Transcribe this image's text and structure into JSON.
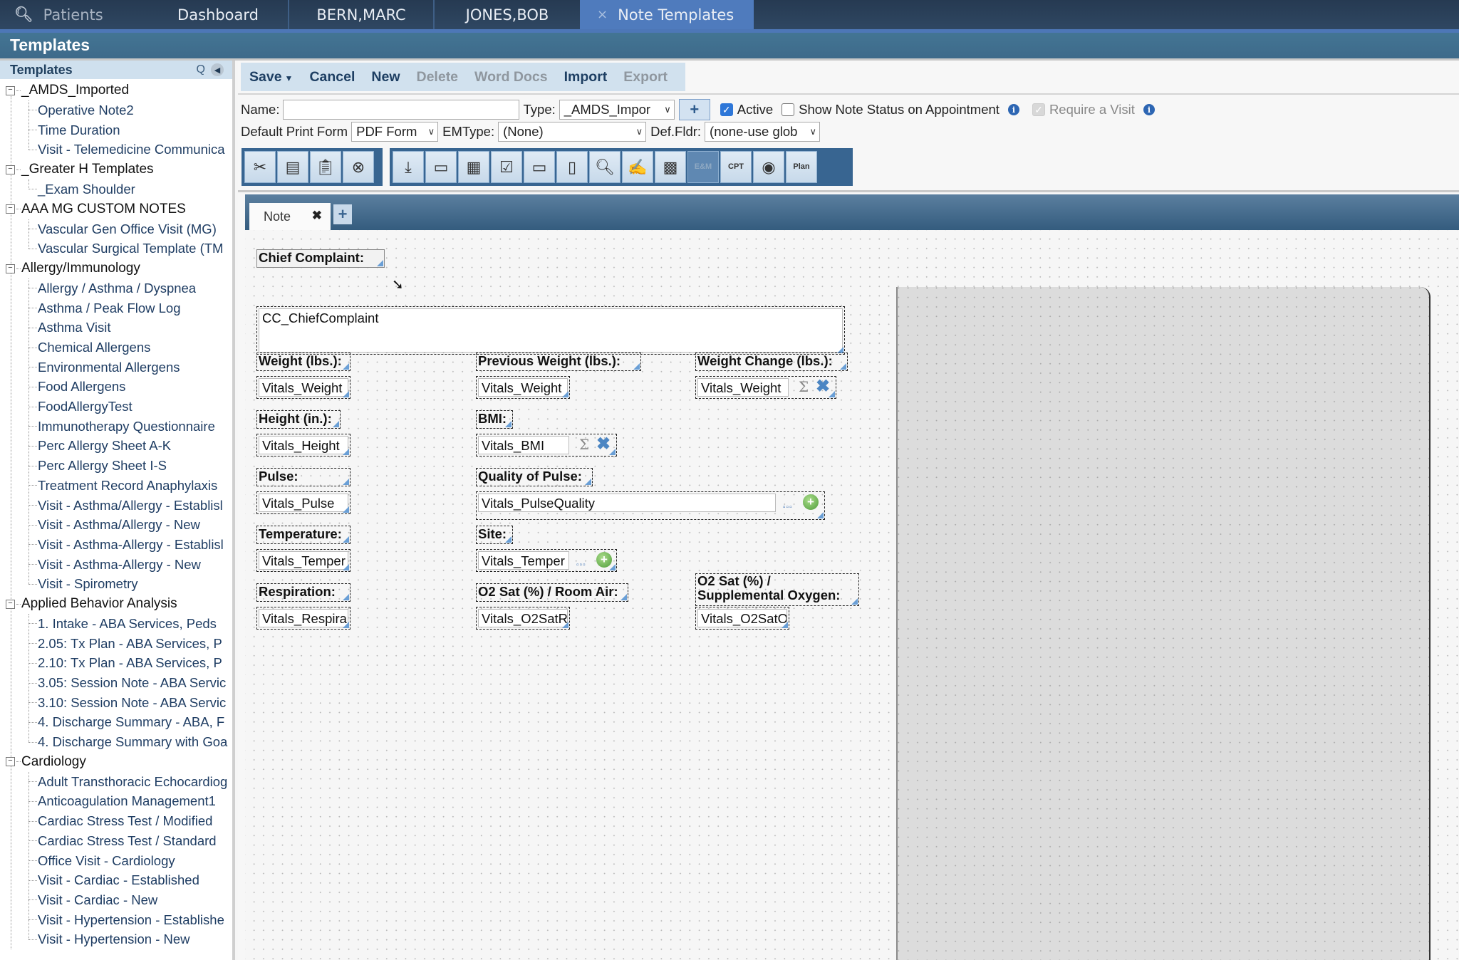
{
  "topnav": {
    "search_label": "Patients",
    "tabs": [
      {
        "label": "Dashboard"
      },
      {
        "label": "BERN,MARC"
      },
      {
        "label": "JONES,BOB"
      },
      {
        "label": "Note Templates",
        "active": true,
        "close": "×"
      }
    ]
  },
  "section_title": "Templates",
  "sidebar": {
    "title": "Templates",
    "search_icon": "Q",
    "collapse_icon": "◀",
    "groups": [
      {
        "label": "_AMDS_Imported",
        "items": [
          "Operative Note2",
          "Time Duration",
          "Visit - Telemedicine Communica"
        ]
      },
      {
        "label": "_Greater H Templates",
        "items": [
          "_Exam Shoulder"
        ]
      },
      {
        "label": "AAA MG CUSTOM NOTES",
        "items": [
          "Vascular Gen Office Visit (MG)",
          "Vascular Surgical Template (TM"
        ]
      },
      {
        "label": "Allergy/Immunology",
        "items": [
          "Allergy / Asthma / Dyspnea",
          "Asthma / Peak Flow Log",
          "Asthma Visit",
          "Chemical Allergens",
          "Environmental Allergens",
          "Food Allergens",
          "FoodAllergyTest",
          "Immunotherapy Questionnaire",
          "Perc Allergy Sheet A-K",
          "Perc Allergy Sheet I-S",
          "Treatment Record Anaphylaxis",
          "Visit - Asthma/Allergy - Establisl",
          "Visit - Asthma/Allergy - New",
          "Visit - Asthma-Allergy - Establisl",
          "Visit - Asthma-Allergy - New",
          "Visit - Spirometry"
        ]
      },
      {
        "label": "Applied Behavior Analysis",
        "items": [
          "1. Intake - ABA Services, Peds",
          "2.05: Tx Plan - ABA Services, P",
          "2.10: Tx Plan - ABA Services, P",
          "3.05: Session Note - ABA Servic",
          "3.10: Session Note - ABA Servic",
          "4. Discharge Summary - ABA, F",
          "4. Discharge Summary with Goa"
        ]
      },
      {
        "label": "Cardiology",
        "items": [
          "Adult Transthoracic Echocardiog",
          "Anticoagulation Management1",
          "Cardiac Stress Test / Modified",
          "Cardiac Stress Test / Standard",
          "Office Visit - Cardiology",
          "Visit - Cardiac - Established",
          "Visit - Cardiac - New",
          "Visit - Hypertension - Establishe",
          "Visit - Hypertension - New"
        ]
      }
    ]
  },
  "actions": {
    "save": "Save",
    "cancel": "Cancel",
    "new": "New",
    "delete": "Delete",
    "word_docs": "Word Docs",
    "import": "Import",
    "export": "Export"
  },
  "form": {
    "name_label": "Name:",
    "name_value": "",
    "type_label": "Type:",
    "type_value": "_AMDS_Impor",
    "add_type": "+",
    "active_label": "Active",
    "active_checked": true,
    "show_status_label": "Show Note Status on Appointment",
    "show_status_checked": false,
    "require_visit_label": "Require a Visit",
    "require_visit_checked": true,
    "print_form_label": "Default Print Form",
    "print_form_value": "PDF Form",
    "emtype_label": "EMType:",
    "emtype_value": "(None)",
    "deffldr_label": "Def.Fldr:",
    "deffldr_value": "(none-use glob"
  },
  "icon_toolbar": {
    "edit_group": [
      "cut-icon",
      "copy-icon",
      "paste-icon",
      "delete-icon"
    ],
    "insert_group": [
      "text-field-icon",
      "textbox-icon",
      "date-grid-icon",
      "checkbox-icon",
      "dropdown-icon",
      "list-icon",
      "lookup-icon",
      "signature-icon",
      "calculator-icon",
      "em-icon",
      "cpt-lookup-icon",
      "radio-icon",
      "plan-icon"
    ],
    "em_label": "E&M",
    "cpt_label": "CPT",
    "plan_label": "Plan"
  },
  "note_tabs": [
    {
      "label": "Note",
      "close": "✖"
    }
  ],
  "add_tab": "+",
  "canvas": {
    "fields": [
      {
        "id": "chief-complaint-label",
        "text": "Chief Complaint:"
      },
      {
        "id": "cc-field",
        "text": "CC_ChiefComplaint"
      },
      {
        "id": "weight-label",
        "text": "Weight (lbs.):"
      },
      {
        "id": "prev-weight-label",
        "text": "Previous Weight (lbs.):"
      },
      {
        "id": "weight-change-label",
        "text": "Weight Change (lbs.):"
      },
      {
        "id": "weight-field",
        "text": "Vitals_Weight"
      },
      {
        "id": "prev-weight-field",
        "text": "Vitals_Weight"
      },
      {
        "id": "weight-change-field",
        "text": "Vitals_Weight"
      },
      {
        "id": "height-label",
        "text": "Height (in.):"
      },
      {
        "id": "bmi-label",
        "text": "BMI:"
      },
      {
        "id": "height-field",
        "text": "Vitals_Height"
      },
      {
        "id": "bmi-field",
        "text": "Vitals_BMI"
      },
      {
        "id": "pulse-label",
        "text": "Pulse:"
      },
      {
        "id": "pulse-quality-label",
        "text": "Quality of Pulse:"
      },
      {
        "id": "pulse-field",
        "text": "Vitals_Pulse"
      },
      {
        "id": "pulse-quality-field",
        "text": "Vitals_PulseQuality"
      },
      {
        "id": "temperature-label",
        "text": "Temperature:"
      },
      {
        "id": "site-label",
        "text": "Site:"
      },
      {
        "id": "temperature-field",
        "text": "Vitals_Temper"
      },
      {
        "id": "site-field",
        "text": "Vitals_Temper"
      },
      {
        "id": "respiration-label",
        "text": "Respiration:"
      },
      {
        "id": "o2-room-label",
        "text": "O2 Sat (%) / Room Air:"
      },
      {
        "id": "o2-supp-label-1",
        "text": "O2 Sat (%) /"
      },
      {
        "id": "o2-supp-label-2",
        "text": "Supplemental Oxygen:"
      },
      {
        "id": "respiration-field",
        "text": "Vitals_Respira"
      },
      {
        "id": "o2-room-field",
        "text": "Vitals_O2SatR"
      },
      {
        "id": "o2-supp-field",
        "text": "Vitals_O2SatO"
      }
    ],
    "sigma": "Σ",
    "remove": "✖",
    "ellipsis": "▫▫▫",
    "add": "+"
  },
  "colors": {
    "nav_bg": "#263a52",
    "active_tab": "#4f7bbd",
    "section_bar": "#437594",
    "link_text": "#1f3d63",
    "toolbar_bg": "#386591"
  }
}
